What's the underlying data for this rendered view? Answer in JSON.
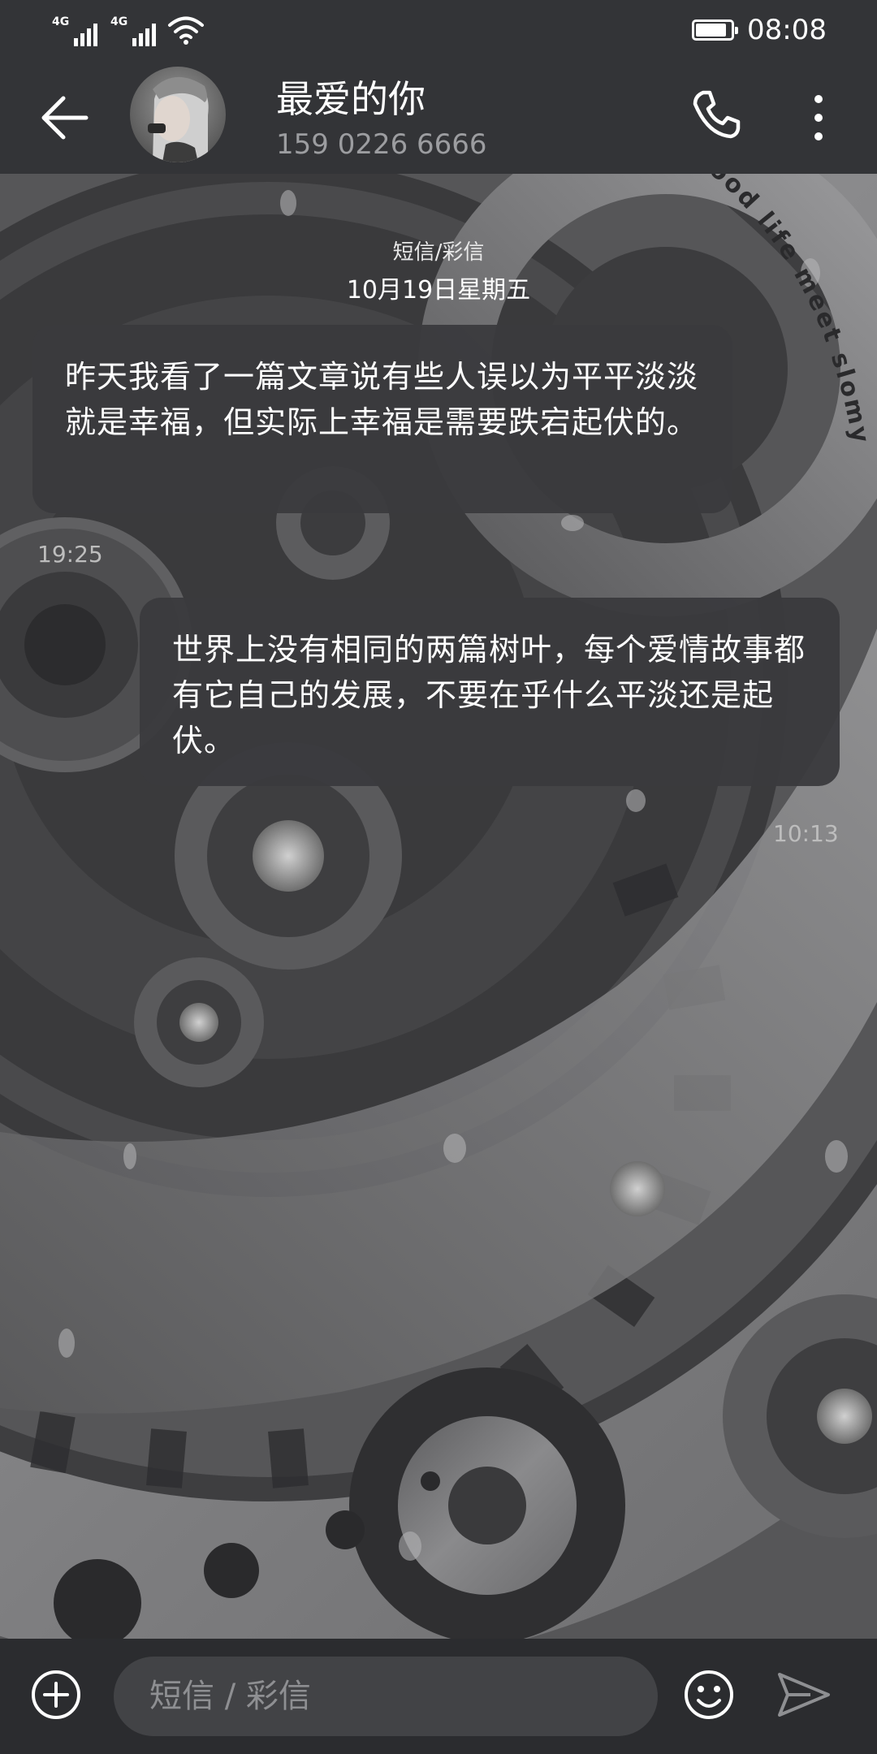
{
  "status_bar": {
    "time": "08:08",
    "network_1": "4G",
    "network_2": "4G",
    "battery_level": 0.9,
    "icons": [
      "signal-icon",
      "signal-icon",
      "wifi-icon",
      "battery-icon"
    ]
  },
  "header": {
    "contact_name": "最爱的你",
    "phone": "159 0226 6666",
    "icons": [
      "back-arrow-icon",
      "avatar-photo",
      "phone-icon",
      "more-vertical-icon"
    ]
  },
  "conversation": {
    "channel_label": "短信/彩信",
    "date_label": "10月19日星期五",
    "messages": [
      {
        "direction": "incoming",
        "text": "昨天我看了一篇文章说有些人误以为平平淡淡就是幸福，但实际上幸福是需要跌宕起伏的。",
        "time": "19:25"
      },
      {
        "direction": "outgoing",
        "text": "世界上没有相同的两篇树叶，每个爱情故事都有它自己的发展，不要在乎什么平淡还是起伏。",
        "time": "10:13"
      }
    ],
    "wallpaper_caption": "Good life meet slomy"
  },
  "composer": {
    "placeholder": "短信 / 彩信",
    "value": "",
    "icons": [
      "add-circle-icon",
      "emoji-icon",
      "send-icon"
    ]
  },
  "colors": {
    "header_bg": "#333437",
    "bubble_bg": "#3a3a3d",
    "composer_bg": "#2b2c2f",
    "input_bg": "#424346",
    "secondary_text": "#9c9da0"
  }
}
